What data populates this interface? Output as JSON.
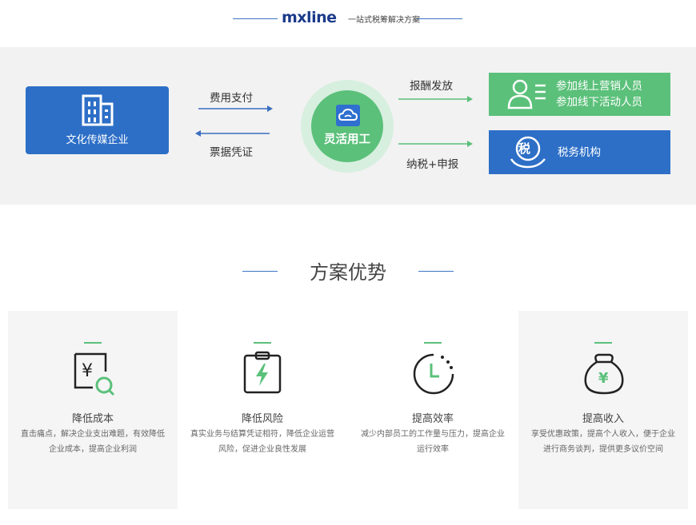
{
  "header": {
    "logo_text": "mxline",
    "slogan": "一站式税筹解决方案"
  },
  "flow": {
    "company": "文化传媒企业",
    "pay_label": "费用支付",
    "invoice_label": "票据凭证",
    "platform": "灵活用工",
    "reward_label": "报酬发放",
    "tax_label": "纳税+申报",
    "people_line1": "参加线上营销人员",
    "people_line2": "参加线下活动人员",
    "tax_icon_text": "税",
    "tax_org": "税务机构"
  },
  "advantages": {
    "title": "方案优势",
    "items": [
      {
        "title": "降低成本",
        "desc": "直击痛点，解决企业支出难题，有效降低企业成本，提高企业利润",
        "icon": "yuan-search-icon"
      },
      {
        "title": "降低风险",
        "desc": "真实业务与结算凭证相符，降低企业运营风险，促进企业良性发展",
        "icon": "clipboard-bolt-icon"
      },
      {
        "title": "提高效率",
        "desc": "减少内部员工的工作量与压力，提高企业运行效率",
        "icon": "clock-icon"
      },
      {
        "title": "提高收入",
        "desc": "享受优惠政策，提高个人收入，便于企业进行商务谈判，提供更多议价空间",
        "icon": "money-bag-icon"
      }
    ]
  },
  "colors": {
    "blue": "#2d6fc7",
    "green": "#5bc07a",
    "band": "#f2f2f2"
  }
}
